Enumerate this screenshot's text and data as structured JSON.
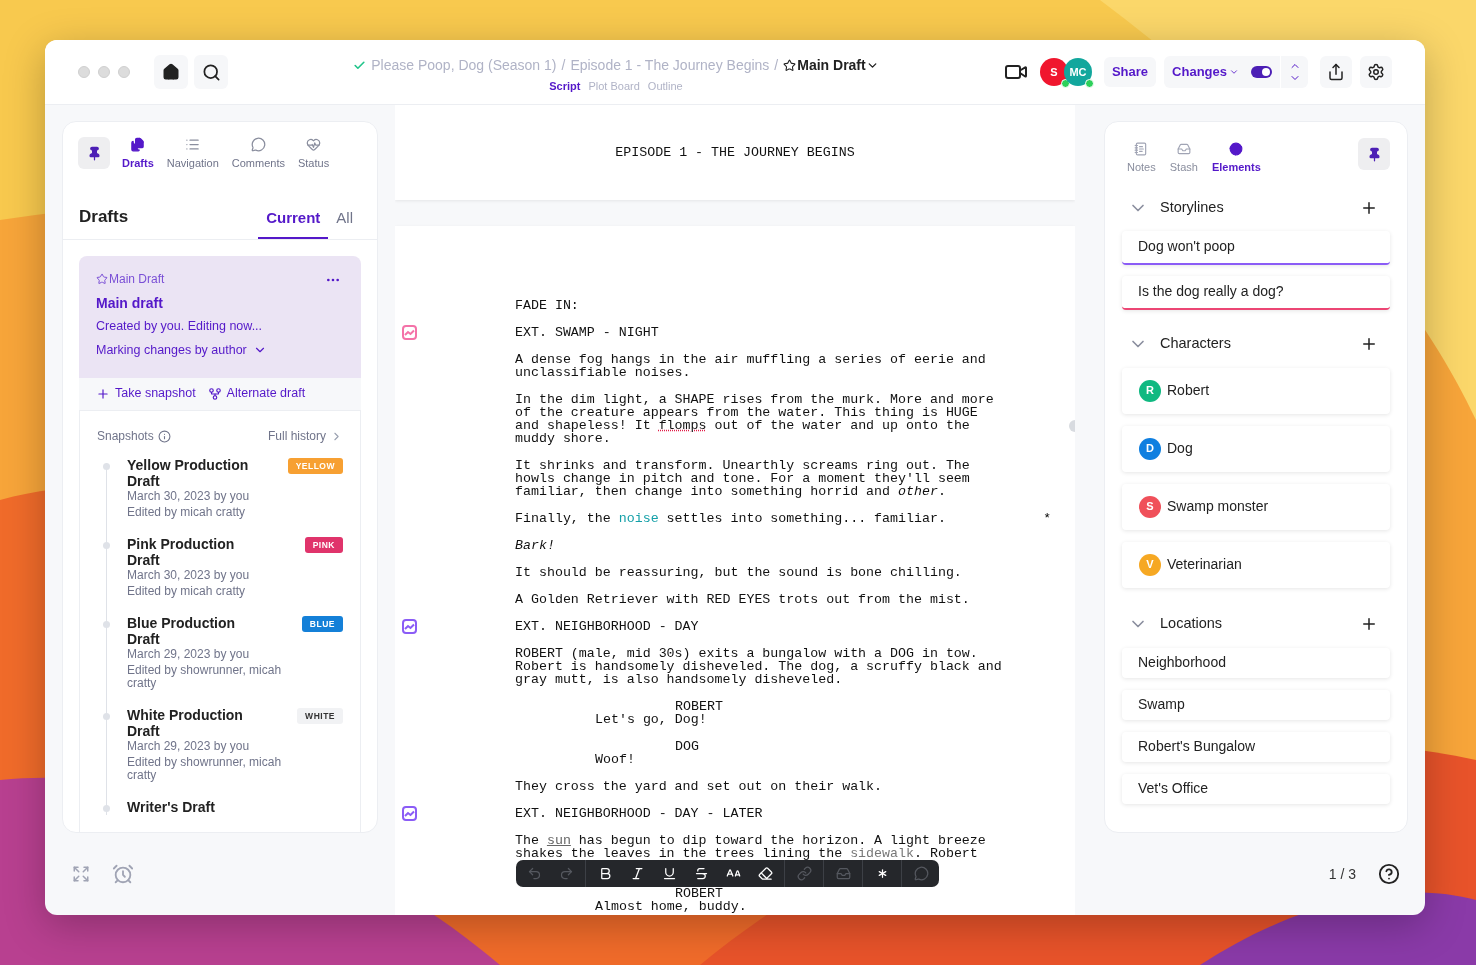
{
  "header": {
    "breadcrumb": [
      "Please Poop, Dog (Season 1)",
      "Episode 1 - The Journey Begins"
    ],
    "separator": "/",
    "draft": "Main Draft",
    "view_tabs": [
      {
        "label": "Script",
        "selected": true
      },
      {
        "label": "Plot Board",
        "selected": false
      },
      {
        "label": "Outline",
        "selected": false
      }
    ],
    "collaborators": [
      {
        "initials": "S",
        "color": "#f0162e",
        "online": true
      },
      {
        "initials": "MC",
        "color": "#12a79d",
        "online": true
      }
    ],
    "share": "Share",
    "changes": {
      "label": "Changes",
      "on": true
    }
  },
  "left_panel": {
    "tabs": [
      {
        "label": "Drafts",
        "kind": "drafts",
        "selected": true
      },
      {
        "label": "Navigation",
        "kind": "navigation",
        "selected": false
      },
      {
        "label": "Comments",
        "kind": "comments",
        "selected": false
      },
      {
        "label": "Status",
        "kind": "status",
        "selected": false
      }
    ],
    "heading": "Drafts",
    "filters": [
      {
        "label": "Current",
        "selected": true
      },
      {
        "label": "All",
        "selected": false
      }
    ],
    "current_draft": {
      "tag": "Main Draft",
      "title": "Main draft",
      "status": "Created by you. Editing now...",
      "marking": "Marking changes by author"
    },
    "actions": [
      {
        "label": "Take snapshot",
        "kind": "snapshot"
      },
      {
        "label": "Alternate draft",
        "kind": "alternate"
      }
    ],
    "snapshots_label": "Snapshots",
    "full_history": "Full history",
    "snapshots": [
      {
        "title": "Yellow Production Draft",
        "badge": "YELLOW",
        "color": "#f7a032",
        "date": "March 30, 2023 by you",
        "edited": "Edited by micah cratty"
      },
      {
        "title": "Pink Production Draft",
        "badge": "PINK",
        "color": "#e0346b",
        "date": "March 30, 2023 by you",
        "edited": "Edited by micah cratty"
      },
      {
        "title": "Blue Production Draft",
        "badge": "BLUE",
        "color": "#1480d8",
        "date": "March 29, 2023 by you",
        "edited": "Edited by showrunner, micah cratty"
      },
      {
        "title": "White Production Draft",
        "badge": "WHITE",
        "color": "#f1f2f4",
        "date": "March 29, 2023 by you",
        "edited": "Edited by showrunner, micah cratty"
      },
      {
        "title": "Writer's Draft"
      }
    ]
  },
  "script": {
    "title_page": "EPISODE 1 - THE JOURNEY BEGINS",
    "lines": [
      {
        "kind": "action",
        "segments": [
          {
            "kind": "plain",
            "text": "FADE IN:"
          }
        ]
      },
      {
        "kind": "scene",
        "color": "#f472a8",
        "segments": [
          {
            "kind": "plain",
            "text": "EXT. SWAMP - NIGHT"
          }
        ]
      },
      {
        "kind": "action",
        "segments": [
          {
            "kind": "plain",
            "text": "A dense fog hangs in the air muffling a series of eerie and unclassifiable noises."
          }
        ]
      },
      {
        "kind": "action",
        "comment": true,
        "segments": [
          {
            "kind": "plain",
            "text": "In the dim light, a SHAPE rises from the murk. More and more of the creature appears from the water. This thing is HUGE and shapeless! It "
          },
          {
            "kind": "misspelled",
            "text": "flomps"
          },
          {
            "kind": "plain",
            "text": " out of the water and up onto the muddy shore."
          }
        ]
      },
      {
        "kind": "action",
        "segments": [
          {
            "kind": "plain",
            "text": "It shrinks and transform. Unearthly screams ring out. The howls change in pitch and tone. For a moment they'll seem familiar, then change into something horrid and "
          },
          {
            "kind": "italic",
            "text": "other"
          },
          {
            "kind": "plain",
            "text": "."
          }
        ]
      },
      {
        "kind": "action",
        "revision": "*",
        "segments": [
          {
            "kind": "plain",
            "text": "Finally, the "
          },
          {
            "kind": "element",
            "text": "noise"
          },
          {
            "kind": "plain",
            "text": " settles into something... familiar."
          }
        ]
      },
      {
        "kind": "action",
        "segments": [
          {
            "kind": "italic",
            "text": "Bark!"
          }
        ]
      },
      {
        "kind": "action",
        "segments": [
          {
            "kind": "plain",
            "text": "It should be reassuring, but the sound is bone chilling."
          }
        ]
      },
      {
        "kind": "action",
        "segments": [
          {
            "kind": "plain",
            "text": "A Golden Retriever with RED EYES trots out from the mist."
          }
        ]
      },
      {
        "kind": "scene",
        "color": "#8b5cf6",
        "segments": [
          {
            "kind": "plain",
            "text": "EXT. NEIGHBORHOOD - DAY"
          }
        ]
      },
      {
        "kind": "action",
        "segments": [
          {
            "kind": "plain",
            "text": "ROBERT (male, mid 30s) exits a bungalow with a DOG in tow. Robert is handsomely disheveled. The dog, a scruffy black and gray mutt, is also handsomely disheveled."
          }
        ]
      },
      {
        "kind": "character",
        "segments": [
          {
            "kind": "plain",
            "text": "ROBERT"
          }
        ]
      },
      {
        "kind": "dialogue",
        "segments": [
          {
            "kind": "plain",
            "text": "Let's go, Dog!"
          }
        ]
      },
      {
        "kind": "character",
        "segments": [
          {
            "kind": "plain",
            "text": "DOG"
          }
        ]
      },
      {
        "kind": "dialogue",
        "segments": [
          {
            "kind": "plain",
            "text": "Woof!"
          }
        ]
      },
      {
        "kind": "action",
        "segments": [
          {
            "kind": "plain",
            "text": "They cross the yard and set out on their walk."
          }
        ]
      },
      {
        "kind": "scene",
        "color": "#8b5cf6",
        "segments": [
          {
            "kind": "plain",
            "text": "EXT. NEIGHBORHOOD - DAY - LATER"
          }
        ]
      },
      {
        "kind": "action",
        "continues": true,
        "segments": [
          {
            "kind": "plain",
            "text": "The "
          },
          {
            "kind": "tagged",
            "text": "sun"
          },
          {
            "kind": "plain",
            "text": " has begun to dip toward the horizon. A light breeze shakes the leaves in the trees lining the "
          },
          {
            "kind": "faded",
            "text": "sidewalk"
          },
          {
            "kind": "plain",
            "text": ". Robert"
          }
        ]
      },
      {
        "kind": "character",
        "segments": [
          {
            "kind": "plain",
            "text": "ROBERT"
          }
        ]
      },
      {
        "kind": "dialogue",
        "segments": [
          {
            "kind": "plain",
            "text": "Almost home, buddy."
          }
        ]
      }
    ]
  },
  "toolbar": [
    {
      "kind": "undo",
      "disabled": true
    },
    {
      "kind": "redo",
      "disabled": true
    },
    {
      "kind": "bold",
      "disabled": false
    },
    {
      "kind": "italic",
      "disabled": false
    },
    {
      "kind": "underline",
      "disabled": false
    },
    {
      "kind": "strike",
      "disabled": false
    },
    {
      "kind": "case",
      "disabled": false
    },
    {
      "kind": "eraser",
      "disabled": false
    },
    {
      "kind": "link",
      "disabled": true
    },
    {
      "kind": "inbox",
      "disabled": true
    },
    {
      "kind": "asterisk",
      "disabled": false
    },
    {
      "kind": "comment",
      "disabled": true
    }
  ],
  "right_panel": {
    "tabs": [
      {
        "label": "Notes",
        "kind": "notes",
        "selected": false
      },
      {
        "label": "Stash",
        "kind": "stash",
        "selected": false
      },
      {
        "label": "Elements",
        "kind": "elements",
        "selected": true
      }
    ],
    "storylines": {
      "title": "Storylines",
      "items": [
        {
          "name": "Dog won't poop",
          "color": "#8b5cf6"
        },
        {
          "name": "Is the dog really a dog?",
          "color": "#ec4674"
        }
      ]
    },
    "characters": {
      "title": "Characters",
      "items": [
        {
          "initial": "R",
          "name": "Robert",
          "color": "#10b981"
        },
        {
          "initial": "D",
          "name": "Dog",
          "color": "#0f7fe0"
        },
        {
          "initial": "S",
          "name": "Swamp monster",
          "color": "#f0505a"
        },
        {
          "initial": "V",
          "name": "Veterinarian",
          "color": "#f6a823"
        }
      ]
    },
    "locations": {
      "title": "Locations",
      "items": [
        {
          "name": "Neighborhood"
        },
        {
          "name": "Swamp"
        },
        {
          "name": "Robert's Bungalow"
        },
        {
          "name": "Vet's Office"
        }
      ]
    }
  },
  "footer": {
    "page": "1 / 3"
  }
}
